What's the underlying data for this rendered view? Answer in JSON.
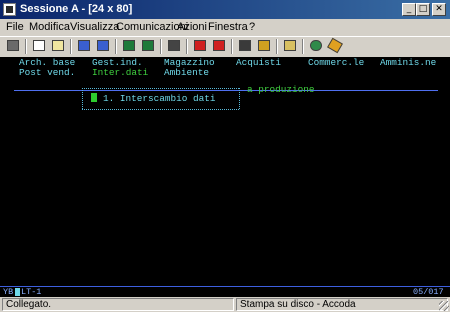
{
  "window": {
    "title": "Sessione A - [24 x 80]",
    "minimize_glyph": "_",
    "maximize_glyph": "□",
    "close_glyph": "✕"
  },
  "menubar": {
    "items": [
      "File",
      "Modifica",
      "Visualizza",
      "Comunicazioni",
      "Azioni",
      "Finestra",
      "?"
    ]
  },
  "toolbar": {
    "buttons": [
      "print-screen-icon",
      "copy-icon",
      "paste-icon",
      "send-icon",
      "receive-icon",
      "display-icon",
      "macro-icon",
      "record-macro-icon",
      "stop-macro-icon",
      "play-macro-icon",
      "play-macro2-icon",
      "clipboard-icon",
      "globe-icon",
      "keypad-icon"
    ]
  },
  "terminal": {
    "menu_row1": [
      "Arch. base",
      "Gest.ind.",
      "Magazzino",
      "Acquisti",
      "Commerc.le",
      "Amminis.ne"
    ],
    "menu_row2_left": "Post vend.",
    "menu_row2_selected": "Inter.dati",
    "menu_row2_right": "Ambiente",
    "popup_dots_top": "...........................",
    "popup_side_text": "a produzione",
    "popup_item": "1. Interscambio dati",
    "colors": {
      "cyan": "#6fd8e8",
      "green": "#3fcf3f",
      "rule": "#4f6ff0"
    }
  },
  "oia": {
    "left": "YB",
    "left2": "LT-1",
    "right": "05/017"
  },
  "statusbar": {
    "connection": "Collegato.",
    "print_mode": "Stampa su disco - Accoda"
  }
}
